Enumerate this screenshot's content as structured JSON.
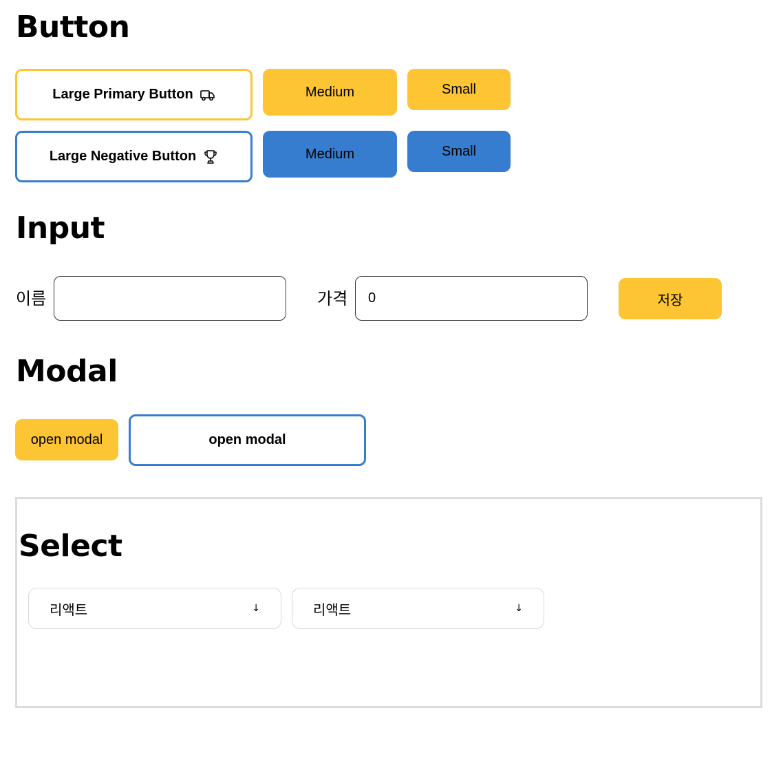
{
  "sections": {
    "button": "Button",
    "input": "Input",
    "modal": "Modal",
    "select": "Select"
  },
  "buttons": {
    "large_primary": "Large Primary Button",
    "large_primary_icon": "truck-icon",
    "primary_medium": "Medium",
    "primary_small": "Small",
    "large_negative": "Large Negative Button",
    "large_negative_icon": "trophy-icon",
    "negative_medium": "Medium",
    "negative_small": "Small"
  },
  "input": {
    "name_label": "이름",
    "name_value": "",
    "price_label": "가격",
    "price_value": "0",
    "save_label": "저장"
  },
  "modal": {
    "open_small": "open modal",
    "open_large": "open modal"
  },
  "select": {
    "first_value": "리액트",
    "second_value": "리액트",
    "arrow": "↓"
  },
  "colors": {
    "primary": "#fdc434",
    "negative": "#377dcf",
    "border_gray": "#dcdcdc"
  }
}
